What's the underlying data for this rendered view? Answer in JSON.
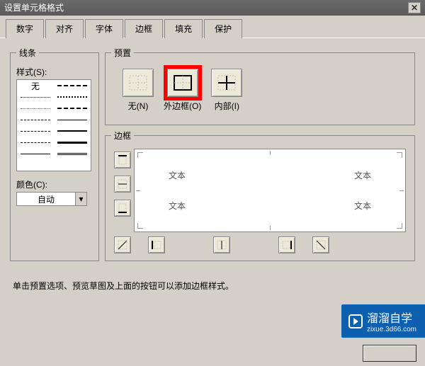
{
  "window": {
    "title": "设置单元格格式"
  },
  "tabs": [
    "数字",
    "对齐",
    "字体",
    "边框",
    "填充",
    "保护"
  ],
  "active_tab_index": 3,
  "lines": {
    "group_label": "线条",
    "style_label": "样式(S):",
    "none_label": "无",
    "color_label": "颜色(C):",
    "color_value": "自动"
  },
  "presets": {
    "group_label": "预置",
    "items": [
      {
        "label": "无(N)",
        "icon": "none"
      },
      {
        "label": "外边框(O)",
        "icon": "outline",
        "highlight": true
      },
      {
        "label": "内部(I)",
        "icon": "inside"
      }
    ]
  },
  "border": {
    "group_label": "边框",
    "sample_text": "文本"
  },
  "hint": "单击预置选项、预览草图及上面的按钮可以添加边框样式。",
  "watermark": {
    "brand": "溜溜自学",
    "url": "zixue.3d66.com"
  }
}
